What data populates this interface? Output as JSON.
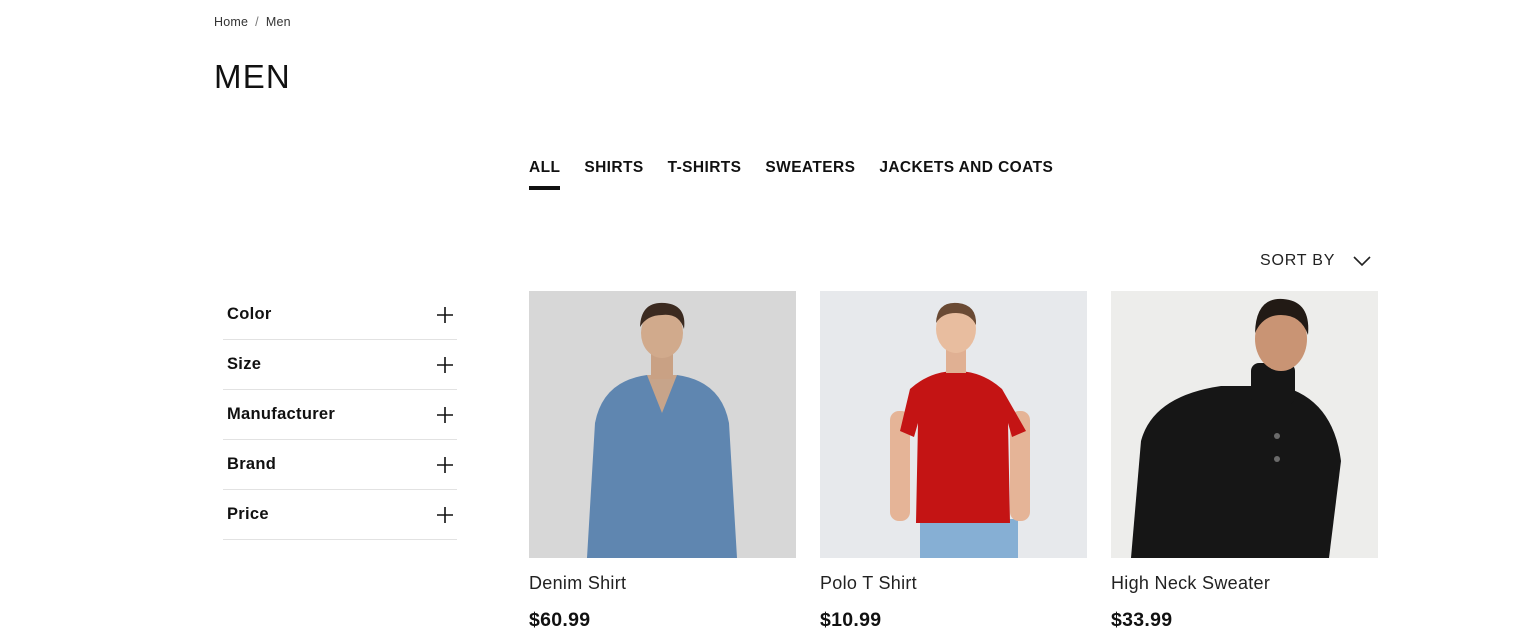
{
  "breadcrumb": {
    "home": "Home",
    "separator": "/",
    "current": "Men"
  },
  "page": {
    "title": "MEN"
  },
  "tabs": [
    {
      "label": "ALL",
      "active": true
    },
    {
      "label": "SHIRTS",
      "active": false
    },
    {
      "label": "T-SHIRTS",
      "active": false
    },
    {
      "label": "SWEATERS",
      "active": false
    },
    {
      "label": "JACKETS AND COATS",
      "active": false
    }
  ],
  "sort": {
    "label": "SORT BY",
    "icon": "chevron-down-icon"
  },
  "filters": [
    {
      "label": "Color",
      "icon": "plus-icon"
    },
    {
      "label": "Size",
      "icon": "plus-icon"
    },
    {
      "label": "Manufacturer",
      "icon": "plus-icon"
    },
    {
      "label": "Brand",
      "icon": "plus-icon"
    },
    {
      "label": "Price",
      "icon": "plus-icon"
    }
  ],
  "products": [
    {
      "name": "Denim Shirt",
      "price": "$60.99",
      "image": "man-in-denim-shirt",
      "shirt_color": "#5f86b0",
      "bg_color": "#d7d7d7"
    },
    {
      "name": "Polo T Shirt",
      "price": "$10.99",
      "image": "man-in-red-polo",
      "shirt_color": "#c41414",
      "bg_color": "#e7e9ec"
    },
    {
      "name": "High Neck Sweater",
      "price": "$33.99",
      "image": "man-in-black-sweater",
      "shirt_color": "#161616",
      "bg_color": "#ededeb"
    }
  ]
}
